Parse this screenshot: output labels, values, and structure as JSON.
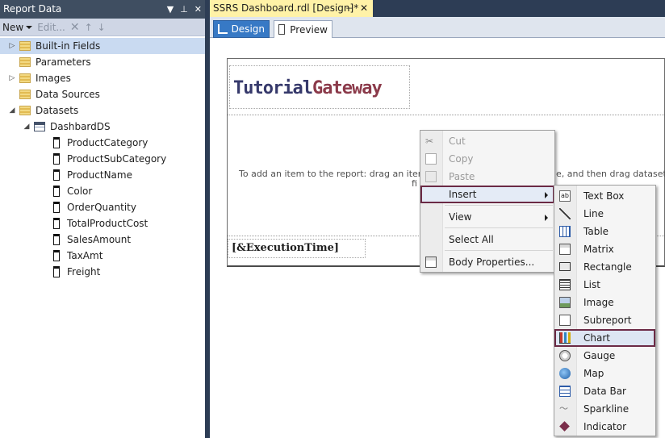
{
  "report_data_panel": {
    "title": "Report Data",
    "toolbar": {
      "new_label": "New",
      "edit_label": "Edit..."
    },
    "tree": {
      "built_in_fields": "Built-in Fields",
      "parameters": "Parameters",
      "images": "Images",
      "data_sources": "Data Sources",
      "datasets": "Datasets",
      "dataset_name": "DashbardDS",
      "fields": [
        "ProductCategory",
        "ProductSubCategory",
        "ProductName",
        "Color",
        "OrderQuantity",
        "TotalProductCost",
        "SalesAmount",
        "TaxAmt",
        "Freight"
      ]
    }
  },
  "document": {
    "tab_title": "SSRS Dashboard.rdl [Design]*",
    "view_tabs": {
      "design": "Design",
      "preview": "Preview"
    }
  },
  "report": {
    "logo_part1": "Tutorial",
    "logo_part2": "Gateway",
    "body_message_line1": "To add an item to the report: drag an item fro",
    "body_message_line1_right": "e, and then drag dataset",
    "body_message_line2": "fi",
    "footer_expression": "[&ExecutionTime]"
  },
  "context_menu": {
    "cut": "Cut",
    "copy": "Copy",
    "paste": "Paste",
    "insert": "Insert",
    "view": "View",
    "select_all": "Select All",
    "body_properties": "Body Properties..."
  },
  "insert_submenu": {
    "items": [
      "Text Box",
      "Line",
      "Table",
      "Matrix",
      "Rectangle",
      "List",
      "Image",
      "Subreport",
      "Chart",
      "Gauge",
      "Map",
      "Data Bar",
      "Sparkline",
      "Indicator"
    ],
    "highlighted": "Chart"
  },
  "colors": {
    "panel_title_bg": "#3f4e61",
    "highlight_outline": "#6b2a45",
    "design_tab_bg": "#3779c5",
    "doc_tab_bg": "#fff2a7",
    "logo_color_1": "#36396b",
    "logo_color_2": "#8b3a4a"
  }
}
